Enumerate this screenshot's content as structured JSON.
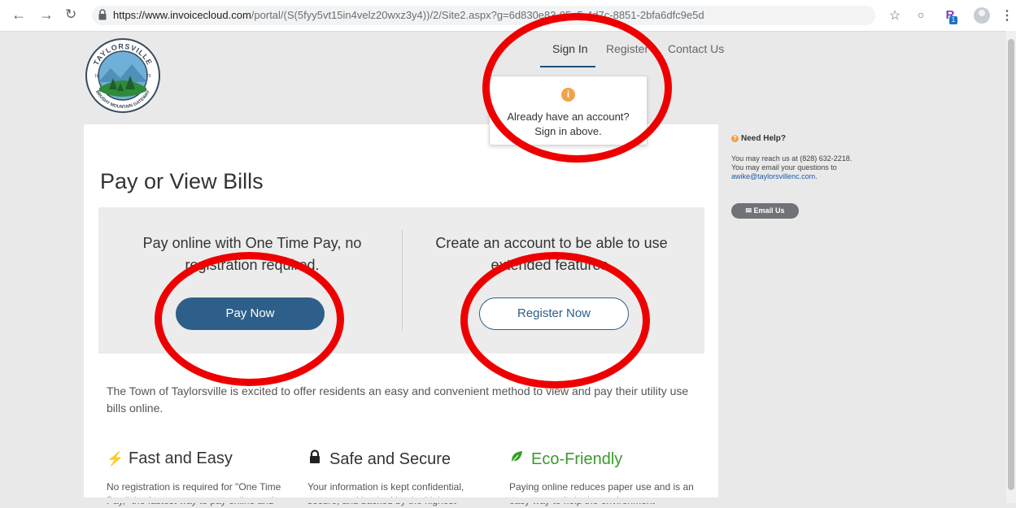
{
  "browser": {
    "url_host": "https://www.invoicecloud.com",
    "url_path": "/portal/(S(5fyy5vt15in4velz20wxz3y4))/2/Site2.aspx?g=6d830e83-05a5-4d7c-8851-2bfa6dfc9e5d",
    "extension_badge": "1",
    "extension_letter": "R"
  },
  "logo": {
    "text": "TAYLORSVILLE",
    "subtext": "BRUSHY MOUNTAIN GATEWAY",
    "year_left": "18",
    "year_right": "79"
  },
  "nav": {
    "sign_in": "Sign In",
    "register": "Register",
    "contact": "Contact Us"
  },
  "tooltip": {
    "icon": "i",
    "line1": "Already have an account?",
    "line2": "Sign in above."
  },
  "main": {
    "title": "Pay or View Bills",
    "option_left": "Pay online with One Time Pay, no registration required.",
    "option_right": "Create an account to be able to use extended features.",
    "pay_button": "Pay Now",
    "register_button": "Register Now",
    "intro": "The Town of Taylorsville is excited to offer residents an easy and convenient method to view and pay their utility use bills online."
  },
  "features": [
    {
      "title": "Fast and Easy",
      "icon": "bolt-icon",
      "desc": "No registration is required for \"One Time Pay,\" the fastest way to pay online and"
    },
    {
      "title": "Safe and Secure",
      "icon": "lock-icon",
      "desc": "Your information is kept confidential, secure, and backed by the highest"
    },
    {
      "title": "Eco-Friendly",
      "icon": "leaf-icon",
      "desc": "Paying online reduces paper use and is an easy way to help the environment"
    }
  ],
  "help": {
    "title": "Need Help?",
    "phone_line": "You may reach us at (828) 632-2218.",
    "email_line": "You may email your questions to",
    "email": "awike@taylorsvillenc.com",
    "email_suffix": ".",
    "email_button": "Email Us"
  },
  "colors": {
    "annotation": "#ee0000",
    "primary": "#2d5f8a",
    "eco": "#3a9a2c",
    "info": "#f0a24a"
  }
}
